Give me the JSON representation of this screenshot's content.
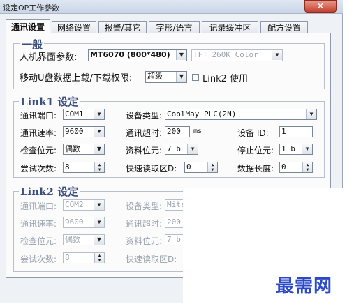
{
  "window": {
    "title": "设定OP工作参数",
    "close_glyph": "✕"
  },
  "tabs": [
    {
      "label": "通讯设置",
      "active": true
    },
    {
      "label": "网络设置",
      "active": false
    },
    {
      "label": "报警/其它",
      "active": false
    },
    {
      "label": "字形/语言",
      "active": false
    },
    {
      "label": "记录缓冲区",
      "active": false
    },
    {
      "label": "配方设置",
      "active": false
    }
  ],
  "general": {
    "legend": "一般",
    "hmi_label": "人机界面参数:",
    "hmi_model": "MT6070 (800*480)",
    "color_mode": "TFT 260K Color",
    "usb_label": "移动U盘数据上载/下载权限:",
    "usb_permission": "超级",
    "link2_label": "Link2 使用"
  },
  "link1": {
    "legend": "Link1 设定",
    "port_label": "通讯端口:",
    "port": "COM1",
    "device_type_label": "设备类型:",
    "device_type": "CoolMay PLC(2N)",
    "baud_label": "通讯速率:",
    "baud": "9600",
    "timeout_label": "通讯超时:",
    "timeout": "200",
    "timeout_unit": "ms",
    "device_id_label": "设备 ID:",
    "device_id": "1",
    "parity_label": "检查位元:",
    "parity": "偶数",
    "data_bits_label": "资料位元:",
    "data_bits": "7 b",
    "stop_bits_label": "停止位元:",
    "stop_bits": "1 b",
    "retry_label": "尝试次数:",
    "retry": "8",
    "fast_read_label": "快速读取区D:",
    "fast_read": "0",
    "data_length_label": "数据长度:",
    "data_length": "0"
  },
  "link2": {
    "legend": "Link2 设定",
    "port_label": "通讯端口:",
    "port": "COM2",
    "device_type_label": "设备类型:",
    "device_type": "Mitsub",
    "baud_label": "通讯速率:",
    "baud": "9600",
    "timeout_label": "通讯超时:",
    "timeout": "200",
    "parity_label": "检查位元:",
    "parity": "偶数",
    "data_bits_label": "资料位元:",
    "data_bits": "7 b",
    "retry_label": "尝试次数:",
    "retry": "8",
    "fast_read_label": "快速读取区D:",
    "fast_read": "0"
  },
  "watermark": "最需网",
  "colors": {
    "legend": "#3a4e7e",
    "watermark": "#2b49c8",
    "close": "#c6412d"
  }
}
